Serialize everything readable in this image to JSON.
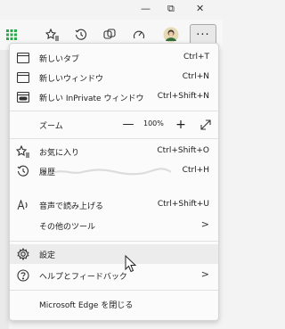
{
  "window": {
    "restore_glyph": "⧉",
    "close_glyph": "✕",
    "minimize_glyph": "—"
  },
  "toolbar": {
    "more_glyph": "···"
  },
  "menu": {
    "new_tab": {
      "label": "新しいタブ",
      "shortcut": "Ctrl+T"
    },
    "new_window": {
      "label": "新しいウィンドウ",
      "shortcut": "Ctrl+N"
    },
    "new_inprivate": {
      "label": "新しい InPrivate ウィンドウ",
      "shortcut": "Ctrl+Shift+N"
    },
    "zoom": {
      "label": "ズーム",
      "minus": "—",
      "value": "100%",
      "plus": "+"
    },
    "favorites": {
      "label": "お気に入り",
      "shortcut": "Ctrl+Shift+O"
    },
    "history": {
      "label": "履歴",
      "shortcut": "Ctrl+H"
    },
    "read_aloud": {
      "label": "音声で読み上げる",
      "shortcut": "Ctrl+Shift+U"
    },
    "more_tools": {
      "label": "その他のツール",
      "chevron": ">"
    },
    "settings": {
      "label": "設定"
    },
    "help_feedback": {
      "label": "ヘルプとフィードバック",
      "chevron": ">"
    },
    "close_edge": {
      "label": "Microsoft Edge を閉じる"
    }
  }
}
